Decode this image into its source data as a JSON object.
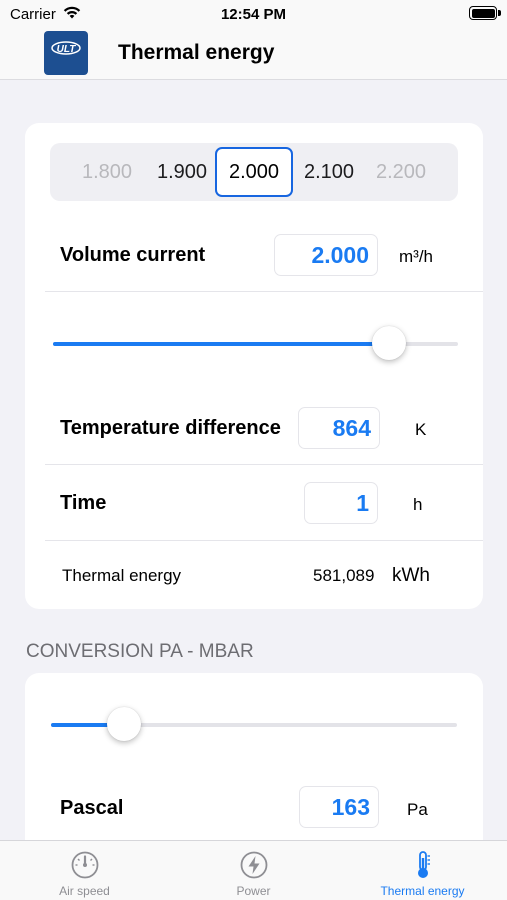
{
  "status_bar": {
    "carrier": "Carrier",
    "time": "12:54 PM"
  },
  "nav": {
    "title": "Thermal energy",
    "logo_text": "ULT",
    "brand_color": "#1d4f91"
  },
  "segmented": {
    "options": [
      "1.800",
      "1.900",
      "2.000",
      "2.100",
      "2.200"
    ],
    "selected_index": 2
  },
  "volume_current": {
    "label": "Volume current",
    "value": "2.000",
    "unit": "m³/h",
    "slider_fraction": 0.83
  },
  "temperature_difference": {
    "label": "Temperature difference",
    "value": "864",
    "unit": "K"
  },
  "time": {
    "label": "Time",
    "value": "1",
    "unit": "h"
  },
  "result": {
    "label": "Thermal energy",
    "value": "581,089",
    "unit": "kWh"
  },
  "conversion": {
    "header": "CONVERSION PA - MBAR",
    "slider_fraction": 0.18,
    "pascal": {
      "label": "Pascal",
      "value": "163",
      "unit": "Pa"
    }
  },
  "tabs": [
    {
      "label": "Air speed",
      "icon": "gauge-icon",
      "active": false
    },
    {
      "label": "Power",
      "icon": "bolt-icon",
      "active": false
    },
    {
      "label": "Thermal energy",
      "icon": "thermometer-icon",
      "active": true
    }
  ],
  "colors": {
    "accent": "#1a7bf2",
    "selected_border": "#1766e0",
    "background": "#f2f2f7"
  }
}
